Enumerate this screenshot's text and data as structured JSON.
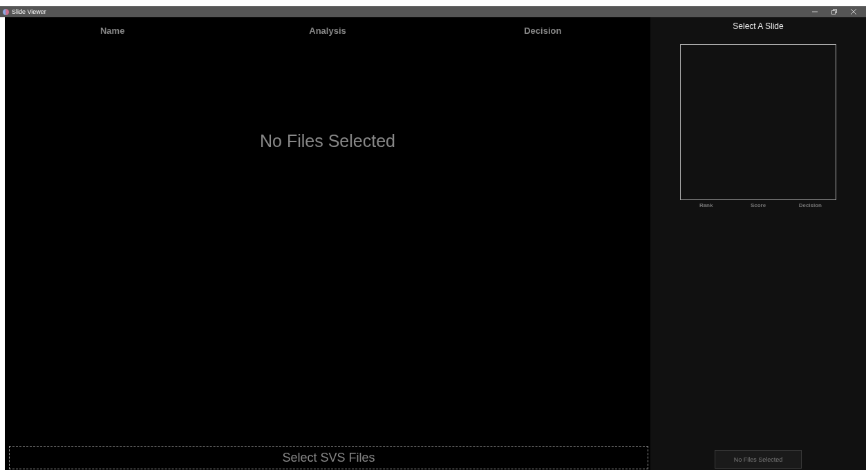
{
  "window": {
    "title": "Slide Viewer"
  },
  "table": {
    "columns": [
      "Name",
      "Analysis",
      "Decision"
    ],
    "empty_message": "No Files Selected"
  },
  "select_button": {
    "label": "Select SVS Files"
  },
  "preview": {
    "title": "Select A Slide",
    "columns": [
      "Rank",
      "Score",
      "Decision"
    ]
  },
  "action_button": {
    "label": "No Files Selected",
    "disabled": true
  }
}
